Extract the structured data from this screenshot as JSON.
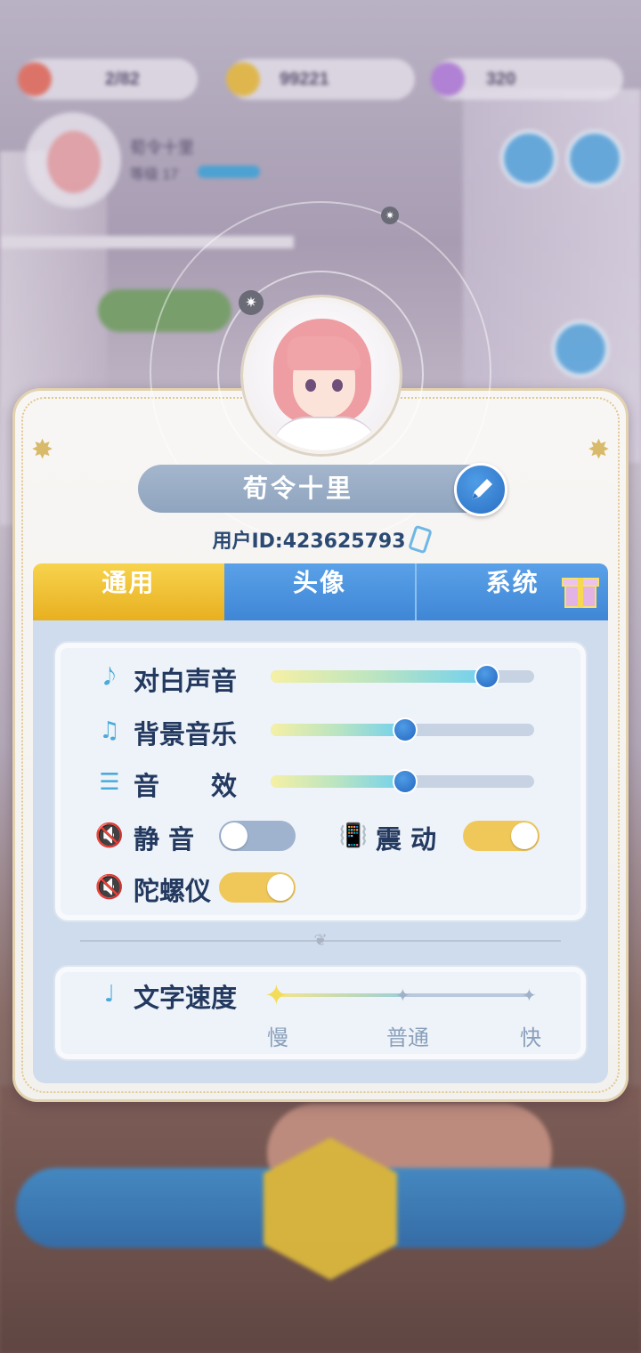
{
  "hud": {
    "stamina": "2/82",
    "coins": "99221",
    "gems": "320",
    "player_name": "荀令十里",
    "level": "等级 17"
  },
  "profile": {
    "name": "荀令十里",
    "uid_label": "用户ID:",
    "uid_value": "423625793"
  },
  "tabs": [
    {
      "label": "通用",
      "active": true
    },
    {
      "label": "头像",
      "active": false
    },
    {
      "label": "系统",
      "active": false
    }
  ],
  "settings": {
    "dialogue_voice": {
      "label": "对白声音",
      "value": 0.82,
      "icon": "voice-note-icon"
    },
    "bgm": {
      "label": "背景音乐",
      "value": 0.51,
      "icon": "music-note-icon"
    },
    "sfx": {
      "label": "音　　效",
      "value": 0.51,
      "icon": "equalizer-icon"
    },
    "mute": {
      "label": "静 音",
      "on": false,
      "icon": "speaker-muted-icon"
    },
    "vibration": {
      "label": "震 动",
      "on": true,
      "icon": "phone-vibrate-icon"
    },
    "gyroscope": {
      "label": "陀螺仪",
      "on": true,
      "icon": "speaker-muted-icon"
    },
    "text_speed": {
      "label": "文字速度",
      "value": "慢",
      "options": [
        "慢",
        "普通",
        "快"
      ]
    }
  },
  "colors": {
    "tab_active": "#f0c030",
    "tab_inactive": "#4a92dc",
    "toggle_on": "#f0c85a",
    "toggle_off": "#9fb3cf",
    "label_text": "#23395f",
    "accent_blue": "#2b6fc4"
  }
}
